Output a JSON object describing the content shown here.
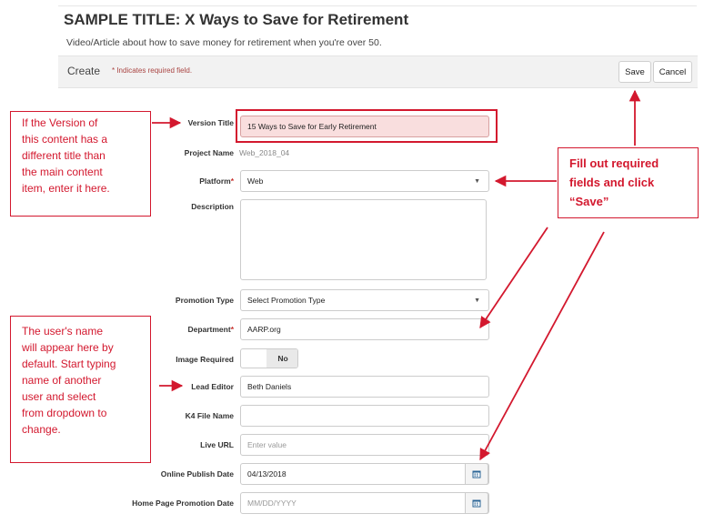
{
  "page": {
    "title": "SAMPLE TITLE: X Ways to Save for Retirement",
    "subtitle": "Video/Article about how to save money for retirement when you're over 50."
  },
  "toolbar": {
    "create_label": "Create",
    "required_note": "* Indicates required field.",
    "save_label": "Save",
    "cancel_label": "Cancel"
  },
  "form": {
    "version_title": {
      "label": "Version Title",
      "value": "15 Ways to Save for Early Retirement"
    },
    "project_name": {
      "label": "Project Name",
      "value": "Web_2018_04"
    },
    "platform": {
      "label": "Platform",
      "required_mark": "*",
      "value": "Web"
    },
    "description": {
      "label": "Description",
      "value": ""
    },
    "promotion_type": {
      "label": "Promotion Type",
      "value": "Select Promotion Type"
    },
    "department": {
      "label": "Department",
      "required_mark": "*",
      "value": "AARP.org"
    },
    "image_required": {
      "label": "Image Required",
      "toggle_label": "No"
    },
    "lead_editor": {
      "label": "Lead Editor",
      "value": "Beth Daniels"
    },
    "k4_file_name": {
      "label": "K4 File Name",
      "value": ""
    },
    "live_url": {
      "label": "Live URL",
      "placeholder": "Enter value"
    },
    "online_publish_date": {
      "label": "Online Publish Date",
      "value": "04/13/2018"
    },
    "home_page_promotion_date": {
      "label": "Home Page Promotion Date",
      "placeholder": "MM/DD/YYYY"
    }
  },
  "annotations": {
    "version_note": [
      "If the Version of",
      "this content has a",
      "different title than",
      "the main content",
      "item, enter it here."
    ],
    "save_note": [
      "Fill out required",
      "fields and click",
      "“Save”"
    ],
    "editor_note": [
      "The user's name",
      "will appear here by",
      "default. Start typing",
      "name of another",
      "user and select",
      "from dropdown to",
      "change."
    ]
  },
  "colors": {
    "annotation_red": "#d3182e",
    "required_red": "#c9302c",
    "highlight_fill": "#f9dede"
  },
  "icons": {
    "select_caret": "caret-down-icon",
    "calendar": "calendar-icon"
  }
}
